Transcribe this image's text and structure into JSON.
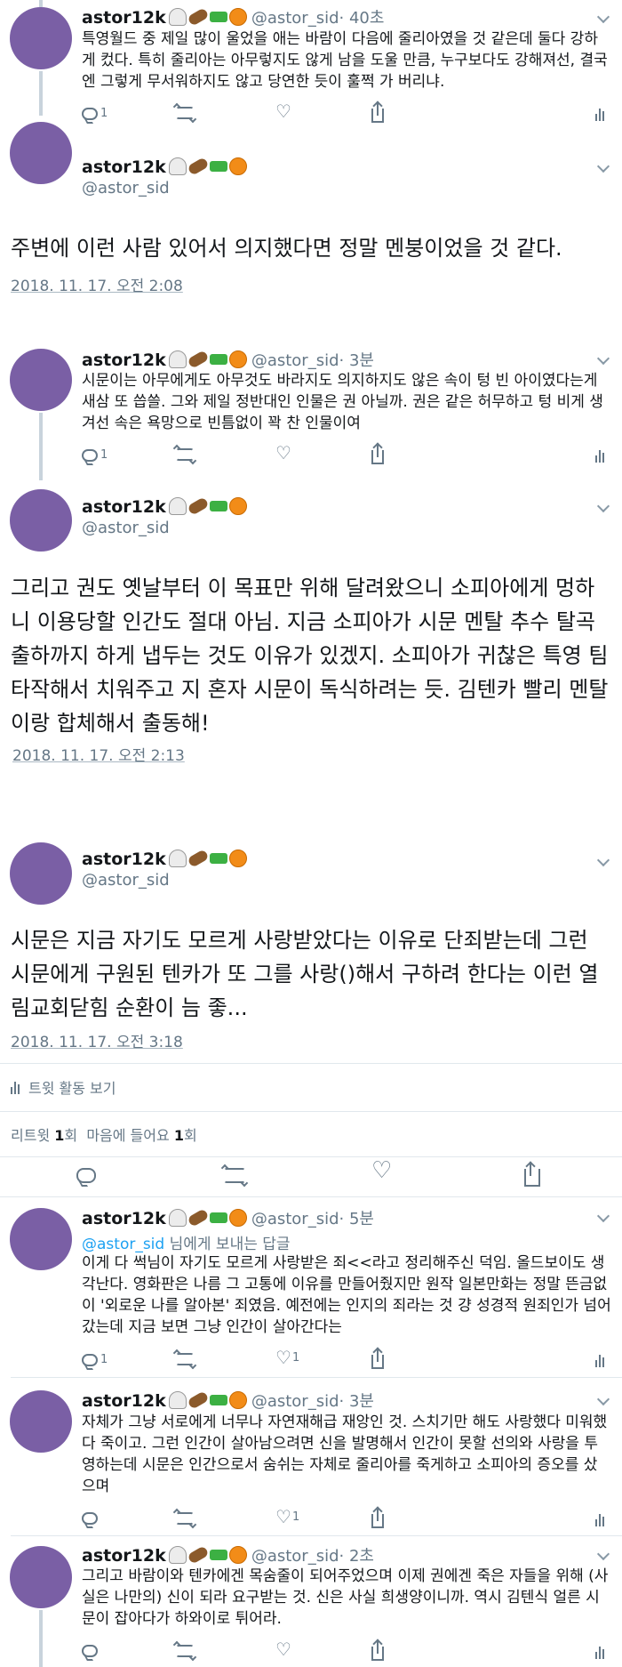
{
  "tweets": [
    {
      "name": "astor12k",
      "handle": "@astor_sid",
      "time": "· 40초",
      "text": "특영월드 중 제일 많이 울었을 애는 바람이 다음에 줄리아였을 것 같은데 둘다 강하게 컸다. 특히 줄리아는 아무렇지도 않게 남을 도울 만큼, 누구보다도 강해져선, 결국엔 그렇게 무서워하지도 않고 당연한 듯이 훌쩍 가 버리냐.",
      "reply_count": "1",
      "like_count": ""
    },
    {
      "name": "astor12k",
      "handle": "@astor_sid",
      "text": "주변에 이런 사람 있어서 의지했다면 정말 멘붕이었을 것 같다.",
      "timestamp": "2018. 11. 17. 오전 2:08"
    },
    {
      "name": "astor12k",
      "handle": "@astor_sid",
      "time": "· 3분",
      "text": "시문이는 아무에게도 아무것도 바라지도 의지하지도 않은 속이 텅 빈 아이였다는게 새삼 또 씁쓸. 그와 제일 정반대인 인물은 권 아닐까. 권은 같은 허무하고 텅 비게 생겨선 속은 욕망으로 빈틈없이 꽉 찬 인물이여",
      "reply_count": "1",
      "like_count": ""
    },
    {
      "name": "astor12k",
      "handle": "@astor_sid",
      "text": "그리고 권도 옛날부터 이 목표만 위해 달려왔으니 소피아에게 멍하니 이용당할 인간도 절대 아님. 지금 소피아가 시문 멘탈 추수 탈곡 출하까지 하게 냅두는 것도 이유가 있겠지. 소피아가 귀찮은 특영 팀 타작해서 치워주고 지 혼자 시문이 독식하려는 듯. 김텐카 빨리 멘탈이랑 합체해서 출동해!",
      "timestamp": "2018. 11. 17. 오전 2:13"
    },
    {
      "name": "astor12k",
      "handle": "@astor_sid",
      "text": "시문은 지금 자기도 모르게 사랑받았다는 이유로 단죄받는데 그런 시문에게 구원된 텐카가 또 그를 사랑()해서 구하려 한다는 이런 열림교회닫힘 순환이 늠 좋...",
      "timestamp": "2018. 11. 17. 오전 3:18",
      "activity": "트윗 활동 보기",
      "retweet_label": "리트윗",
      "retweet_count": "1",
      "retweet_unit": "회",
      "like_label": "마음에 들어요",
      "like_count": "1",
      "like_unit": "회"
    },
    {
      "name": "astor12k",
      "handle": "@astor_sid",
      "time": "· 5분",
      "reply_to_mention": "@astor_sid",
      "reply_to_suffix": " 님에게 보내는 답글",
      "text": "이게 다 썩님이 자기도 모르게 사랑받은 죄<<라고 정리해주신 덕임. 올드보이도 생각난다. 영화판은 나름 그 고통에 이유를 만들어줬지만 원작 일본만화는 정말 뜬금없이 '외로운 나를 알아본' 죄였음. 예전에는 인지의 죄라는 것 걍 성경적 원죄인가 넘어갔는데 지금 보면 그냥 인간이 살아간다는",
      "reply_count": "1",
      "like_count": "1"
    },
    {
      "name": "astor12k",
      "handle": "@astor_sid",
      "time": "· 3분",
      "text": "자체가 그냥 서로에게 너무나 자연재해급 재앙인 것. 스치기만 해도 사랑했다 미워했다 죽이고. 그런 인간이 살아남으려면 신을 발명해서 인간이 못할 선의와 사랑을 투영하는데 시문은 인간으로서 숨쉬는 자체로 줄리아를 죽게하고 소피아의 증오를 샀으며",
      "reply_count": "",
      "like_count": "1"
    },
    {
      "name": "astor12k",
      "handle": "@astor_sid",
      "time": "· 2초",
      "text": "그리고 바람이와 텐카에겐 목숨줄이 되어주었으며 이제 권에겐 죽은 자들을 위해 (사실은 나만의) 신이 되라 요구받는 것. 신은 사실 희생양이니까. 역시 김텐식 얼른 시문이 잡아다가 하와이로 튀어라.",
      "reply_count": "",
      "like_count": ""
    }
  ],
  "icons": [
    "ghost-emoji",
    "coffin-emoji",
    "water-pistol-emoji",
    "jack-o-lantern-emoji",
    "reply-icon",
    "retweet-icon",
    "like-icon",
    "share-icon",
    "stats-icon",
    "chevron-down-icon"
  ],
  "colors": {
    "avatar": "#7a5fa5",
    "accent": "#1da1f2",
    "muted": "#657786",
    "thread_line": "#c8d3dc"
  }
}
